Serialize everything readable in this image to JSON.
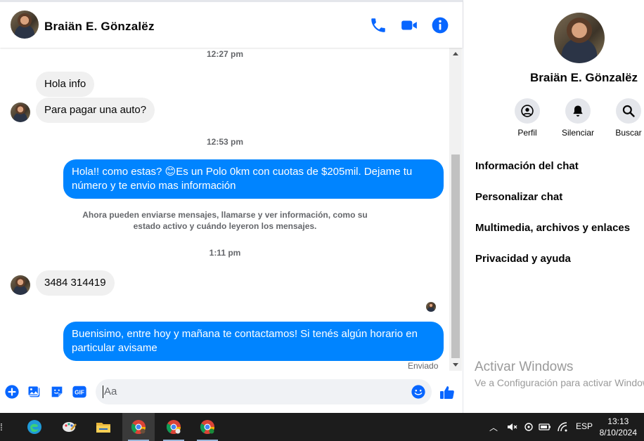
{
  "header": {
    "contact_name": "Braiän E. Gönzalëz",
    "call_icon": "phone-icon",
    "video_icon": "video-camera-icon",
    "info_icon": "info-icon"
  },
  "conversation": {
    "timestamps": [
      "12:27 pm",
      "12:53 pm",
      "1:11 pm"
    ],
    "messages": [
      {
        "from": "contact",
        "text": "Hola info"
      },
      {
        "from": "contact",
        "text": "Para pagar una auto?"
      },
      {
        "from": "me",
        "text": "Hola!! como estas? 😊Es un Polo 0km con cuotas de $205mil. Dejame tu número y te envio mas información"
      },
      {
        "from": "contact",
        "text": "3484 314419"
      },
      {
        "from": "me",
        "text": "Buenisimo, entre hoy y mañana te contactamos! Si tenés algún horario en particular avisame"
      }
    ],
    "notice": "Ahora pueden enviarse mensajes, llamarse y ver información, como su estado activo y cuándo leyeron los mensajes.",
    "delivery_status": "Enviado"
  },
  "composer": {
    "placeholder": "Aa",
    "icons": [
      "plus-icon",
      "photo-icon",
      "sticker-icon",
      "gif-icon",
      "emoji-icon",
      "thumbs-up-icon"
    ],
    "gif_label": "GIF"
  },
  "sidebar": {
    "name": "Braiän E. Gönzalëz",
    "actions": [
      {
        "label": "Perfil",
        "icon": "profile-icon"
      },
      {
        "label": "Silenciar",
        "icon": "bell-icon"
      },
      {
        "label": "Buscar",
        "icon": "search-icon"
      }
    ],
    "menu": [
      "Información del chat",
      "Personalizar chat",
      "Multimedia, archivos y enlaces",
      "Privacidad y ayuda"
    ]
  },
  "watermark": {
    "title": "Activar Windows",
    "subtitle": "Ve a Configuración para activar Windows."
  },
  "taskbar": {
    "apps": [
      "edge-icon",
      "paint-icon",
      "file-explorer-icon",
      "chrome-icon",
      "chrome-profile-icon",
      "chrome-profile-t-icon"
    ],
    "language": "ESP",
    "time": "13:13",
    "date": "8/10/2024"
  },
  "colors": {
    "accent": "#0084ff",
    "messenger_blue": "#0866ff"
  }
}
